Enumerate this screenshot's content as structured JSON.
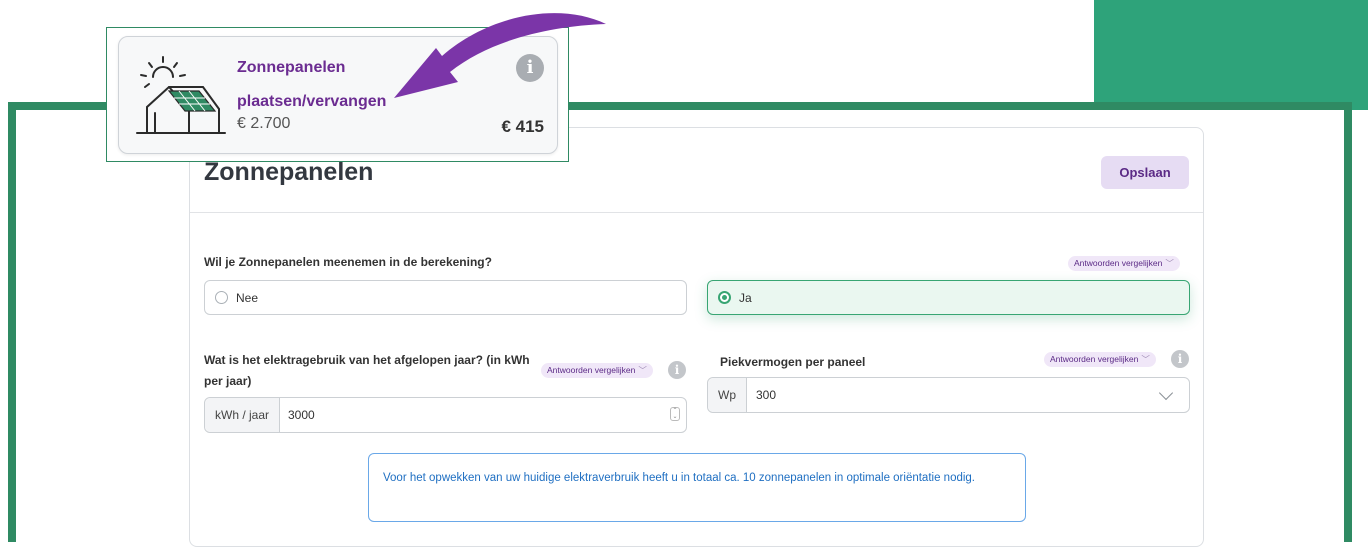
{
  "tile": {
    "title": "Zonnepanelen plaatsen/vervangen",
    "price": "€ 2.700",
    "amount": "€ 415",
    "info_icon": "info-icon",
    "illustration_icon": "solar-house-icon"
  },
  "panel": {
    "title": "Zonnepanelen",
    "save_label": "Opslaan"
  },
  "question1": {
    "label": "Wil je Zonnepanelen meenemen in de berekening?",
    "compare_label": "Antwoorden vergelijken",
    "options": [
      {
        "label": "Nee",
        "selected": false
      },
      {
        "label": "Ja",
        "selected": true
      }
    ]
  },
  "question2": {
    "label": "Wat is het elektragebruik van het afgelopen jaar? (in kWh per jaar)",
    "compare_label": "Antwoorden vergelijken",
    "unit": "kWh / jaar",
    "value": "3000"
  },
  "question3": {
    "label": "Piekvermogen per paneel",
    "compare_label": "Antwoorden vergelijken",
    "unit": "Wp",
    "value": "300"
  },
  "notice": {
    "text": "Voor het opwekken van uw huidige elektraverbruik heeft u in totaal ca. 10 zonnepanelen in optimale oriëntatie nodig."
  },
  "colors": {
    "frame_green": "#2f8a63",
    "accent_green": "#2ea37a",
    "purple": "#6b2c91",
    "arrow_purple": "#7b35a8",
    "info_blue": "#1f6fc2"
  }
}
